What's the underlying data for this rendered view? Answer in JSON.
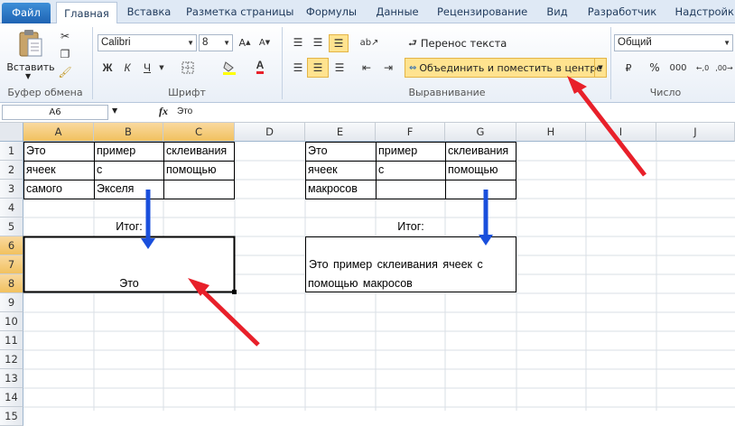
{
  "tabs": [
    "Файл",
    "Главная",
    "Вставка",
    "Разметка страницы",
    "Формулы",
    "Данные",
    "Рецензирование",
    "Вид",
    "Разработчик",
    "Надстройки"
  ],
  "clipboard": {
    "paste_label": "Вставить",
    "group": "Буфер обмена"
  },
  "font": {
    "name": "Calibri",
    "size": "8",
    "bold": "Ж",
    "italic": "К",
    "underline": "Ч",
    "group": "Шрифт"
  },
  "alignment": {
    "wrap": "Перенос текста",
    "merge": "Объединить и поместить в центре",
    "group": "Выравнивание"
  },
  "number": {
    "format": "Общий",
    "group": "Число",
    "currency": "₽",
    "percent": "%",
    "thousands": "000"
  },
  "formula_bar": {
    "name_box": "A6",
    "fx": "fx",
    "content": "Это"
  },
  "columns": [
    "A",
    "B",
    "C",
    "D",
    "E",
    "F",
    "G",
    "H",
    "I",
    "J"
  ],
  "rows": [
    "1",
    "2",
    "3",
    "4",
    "5",
    "6",
    "7",
    "8",
    "9",
    "10",
    "11",
    "12",
    "13",
    "14",
    "15"
  ],
  "cells": {
    "A1": "Это",
    "B1": "пример",
    "C1": "склеивания",
    "A2": "ячеек",
    "B2": "с",
    "C2": "помощью",
    "A3": "самого",
    "B3": "Экселя",
    "AB5": "Итог:",
    "A68": "Это",
    "E1": "Это",
    "F1": "пример",
    "G1": "склеивания",
    "E2": "ячеек",
    "F2": "с",
    "G2": "помощью",
    "E3": "макросов",
    "EF5": "Итог:",
    "E7": "Это пример склеивания ячеек с",
    "E8": "помощью макросов"
  },
  "colors": {
    "accent": "#1f63b3",
    "arrow_red": "#e8202a",
    "arrow_blue": "#1a4fdc",
    "highlight": "#ffe38f"
  }
}
